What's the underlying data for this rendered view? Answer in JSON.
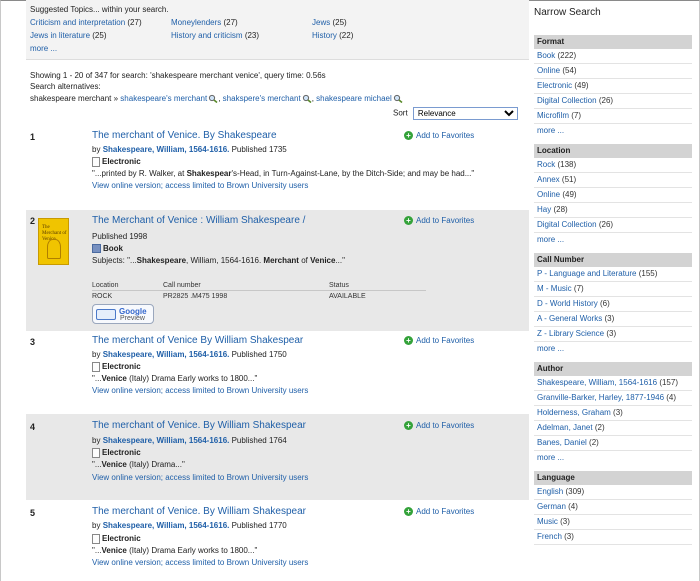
{
  "suggest": {
    "label": "Suggested Topics... within your search.",
    "topics": [
      {
        "name": "Criticism and interpretation",
        "count": "(27)"
      },
      {
        "name": "Moneylenders",
        "count": "(27)"
      },
      {
        "name": "Jews",
        "count": "(25)"
      },
      {
        "name": "Jews in literature",
        "count": "(25)"
      },
      {
        "name": "History and criticism",
        "count": "(23)"
      },
      {
        "name": "History",
        "count": "(22)"
      }
    ],
    "more": "more ..."
  },
  "summary": {
    "showing": "Showing 1 - 20 of 347 for search: 'shakespeare merchant venice', query time: 0.56s",
    "alts_label": "Search alternatives:",
    "alts_prefix": "shakespeare merchant »",
    "alts": [
      "shakespeare's merchant",
      "shakspere's merchant",
      "shakespeare michael"
    ],
    "sep": ","
  },
  "sort": {
    "label": "Sort",
    "value": "Relevance"
  },
  "fav_label": "Add to Favorites",
  "results": [
    {
      "num": "1",
      "title": "The merchant of Venice. By Shakespeare",
      "by": "by",
      "author": "Shakespeare, William, 1564-1616.",
      "published": "Published 1735",
      "format": "Electronic",
      "snippet_pre": "\"...printed by R. Walker, at ",
      "snippet_b1": "Shakespear",
      "snippet_post": "'s-Head, in Turn-Against-Lane, by the Ditch-Side; and may be had...\"",
      "online": "View online version; access limited to Brown University users"
    },
    {
      "num": "2",
      "title": "The Merchant of Venice : William Shakespeare /",
      "published": "Published 1998",
      "format": "Book",
      "subjects_label": "Subjects:",
      "subj_pre": "\"...",
      "subj_b1": "Shakespeare",
      "subj_mid": ", William, 1564-1616. ",
      "subj_b2": "Merchant",
      "subj_mid2": " of ",
      "subj_b3": "Venice",
      "subj_post": "...\"",
      "cover_text": "The Merchant of Venice",
      "holdings": {
        "headers": [
          "Location",
          "Call number",
          "Status"
        ],
        "row": [
          "ROCK",
          "PR2825 .M475 1998",
          "AVAILABLE"
        ]
      },
      "google_preview": {
        "line1": "Google",
        "line2": "Preview"
      }
    },
    {
      "num": "3",
      "title": "The merchant of Venice By William Shakespear",
      "by": "by",
      "author": "Shakespeare, William, 1564-1616.",
      "published": "Published 1750",
      "format": "Electronic",
      "snippet_pre": "\"...",
      "snippet_b1": "Venice",
      "snippet_post": " (Italy) Drama Early works to 1800...\"",
      "online": "View online version; access limited to Brown University users"
    },
    {
      "num": "4",
      "title": "The merchant of Venice. By William Shakespear",
      "by": "by",
      "author": "Shakespeare, William, 1564-1616.",
      "published": "Published 1764",
      "format": "Electronic",
      "snippet_pre": "\"...",
      "snippet_b1": "Venice",
      "snippet_post": " (Italy) Drama...\"",
      "online": "View online version; access limited to Brown University users"
    },
    {
      "num": "5",
      "title": "The merchant of Venice. By William Shakespear",
      "by": "by",
      "author": "Shakespeare, William, 1564-1616.",
      "published": "Published 1770",
      "format": "Electronic",
      "snippet_pre": "\"...",
      "snippet_b1": "Venice",
      "snippet_post": " (Italy) Drama Early works to 1800...\"",
      "online": "View online version; access limited to Brown University users"
    }
  ],
  "sidebar": {
    "title": "Narrow Search",
    "facets": [
      {
        "heading": "Format",
        "items": [
          {
            "name": "Book",
            "count": "(222)"
          },
          {
            "name": "Online",
            "count": "(54)"
          },
          {
            "name": "Electronic",
            "count": "(49)"
          },
          {
            "name": "Digital Collection",
            "count": "(26)"
          },
          {
            "name": "Microfilm",
            "count": "(7)"
          }
        ],
        "more": "more ..."
      },
      {
        "heading": "Location",
        "items": [
          {
            "name": "Rock",
            "count": "(138)"
          },
          {
            "name": "Annex",
            "count": "(51)"
          },
          {
            "name": "Online",
            "count": "(49)"
          },
          {
            "name": "Hay",
            "count": "(28)"
          },
          {
            "name": "Digital Collection",
            "count": "(26)"
          }
        ],
        "more": "more ..."
      },
      {
        "heading": "Call Number",
        "items": [
          {
            "name": "P - Language and Literature",
            "count": "(155)"
          },
          {
            "name": "M - Music",
            "count": "(7)"
          },
          {
            "name": "D - World History",
            "count": "(6)"
          },
          {
            "name": "A - General Works",
            "count": "(3)"
          },
          {
            "name": "Z - Library Science",
            "count": "(3)"
          }
        ],
        "more": "more ..."
      },
      {
        "heading": "Author",
        "items": [
          {
            "name": "Shakespeare, William, 1564-1616",
            "count": "(157)"
          },
          {
            "name": "Granville-Barker, Harley, 1877-1946",
            "count": "(4)"
          },
          {
            "name": "Holderness, Graham",
            "count": "(3)"
          },
          {
            "name": "Adelman, Janet",
            "count": "(2)"
          },
          {
            "name": "Banes, Daniel",
            "count": "(2)"
          }
        ],
        "more": "more ..."
      },
      {
        "heading": "Language",
        "items": [
          {
            "name": "English",
            "count": "(309)"
          },
          {
            "name": "German",
            "count": "(4)"
          },
          {
            "name": "Music",
            "count": "(3)"
          },
          {
            "name": "French",
            "count": "(3)"
          }
        ]
      }
    ]
  }
}
